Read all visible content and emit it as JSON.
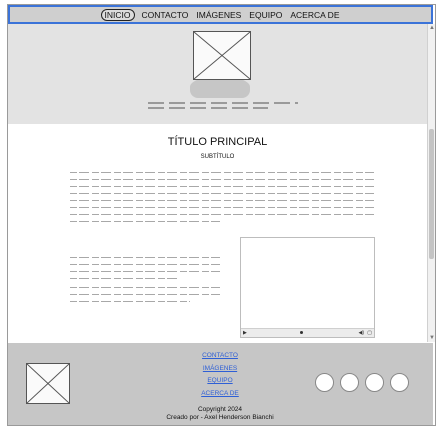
{
  "nav": {
    "items": [
      "INICIO",
      "CONTACTO",
      "IMÁGENES",
      "EQUIPO",
      "ACERCA DE"
    ]
  },
  "main": {
    "title": "TÍTULO PRINCIPAL",
    "subtitle": "SUBTÍTULO"
  },
  "footer": {
    "links": [
      "CONTACTO",
      "IMÁGENES",
      "EQUIPO",
      "ACERCA DE"
    ],
    "copyright": "Copyright 2024",
    "credit": "Creado por - Axel Henderson Bianchi",
    "social_count": 4
  },
  "colors": {
    "nav_border": "#3b73d8",
    "link": "#2e5fd6",
    "footer_bg": "#c6c6c6",
    "hero_bg": "#e3e3e3"
  }
}
